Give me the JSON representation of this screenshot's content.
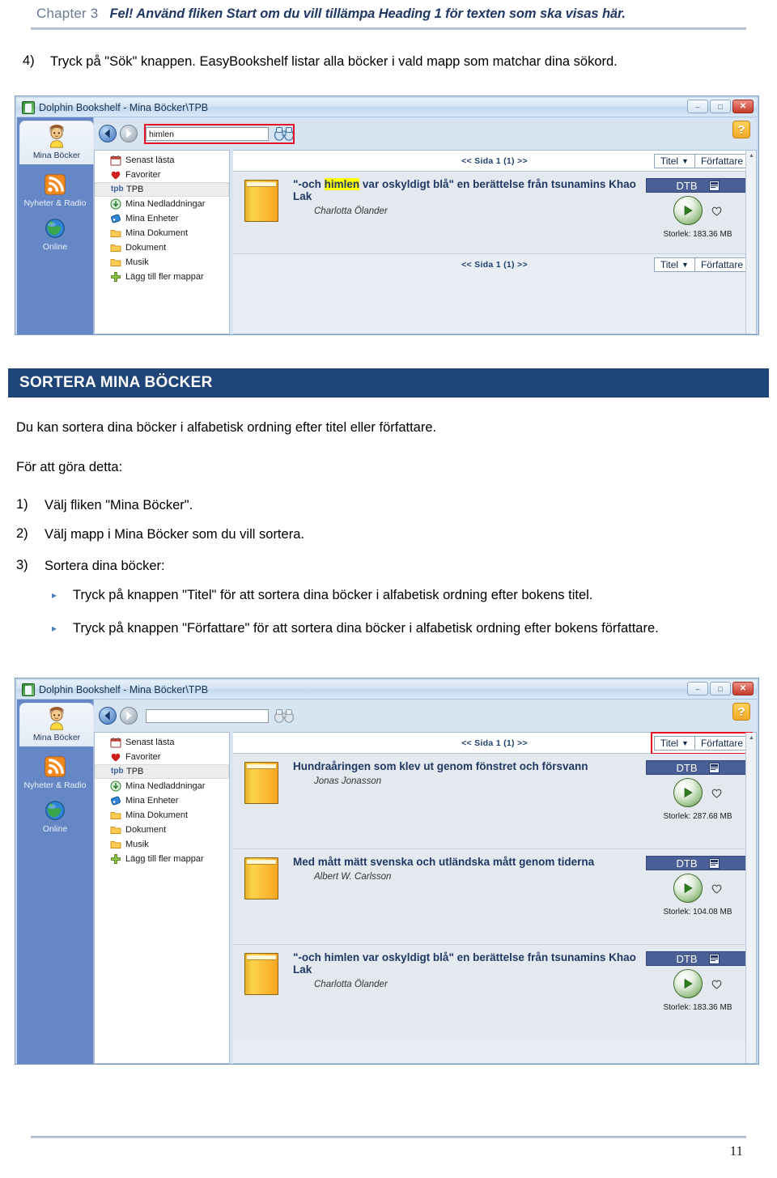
{
  "header": {
    "chapter": "Chapter 3",
    "title": "Fel! Använd fliken Start om du vill tillämpa Heading 1 för texten som ska visas här."
  },
  "body": {
    "step4_num": "4)",
    "step4_text": "Tryck på \"Sök\" knappen. EasyBookshelf listar alla böcker i vald mapp som matchar dina sökord.",
    "section_heading": "SORTERA MINA BÖCKER",
    "intro": "Du kan sortera dina böcker i alfabetisk ordning efter titel eller författare.",
    "howto": "För att göra detta:",
    "step1_num": "1)",
    "step1_text": "Välj fliken \"Mina Böcker\".",
    "step2_num": "2)",
    "step2_text": "Välj mapp i Mina Böcker som du vill sortera.",
    "step3_num": "3)",
    "step3_text": "Sortera dina böcker:",
    "bullet1": "Tryck på knappen \"Titel\" för att sortera dina böcker i alfabetisk ordning efter bokens titel.",
    "bullet2": "Tryck på knappen \"Författare\" för att sortera dina böcker i alfabetisk ordning efter bokens författare.",
    "bullet_glyph": "▸"
  },
  "footer": {
    "page_number": "11"
  },
  "app": {
    "window_title": "Dolphin Bookshelf - Mina Böcker\\TPB",
    "min_label": "–",
    "max_label": "□",
    "close_label": "✕",
    "help_label": "?",
    "rail": [
      {
        "label": "Mina Böcker",
        "icon": "user-avatar-icon"
      },
      {
        "label": "Nyheter & Radio",
        "icon": "rss-icon"
      },
      {
        "label": "Online",
        "icon": "globe-icon"
      }
    ],
    "tree": [
      {
        "label": "Senast lästa",
        "icon": "calendar-icon"
      },
      {
        "label": "Favoriter",
        "icon": "heart-icon"
      },
      {
        "label": "TPB",
        "icon": "tpb-icon"
      },
      {
        "label": "Mina Nedladdningar",
        "icon": "download-icon"
      },
      {
        "label": "Mina Enheter",
        "icon": "device-icon"
      },
      {
        "label": "Mina Dokument",
        "icon": "folder-icon"
      },
      {
        "label": "Dokument",
        "icon": "folder-icon"
      },
      {
        "label": "Musik",
        "icon": "folder-icon"
      },
      {
        "label": "Lägg till fler mappar",
        "icon": "plus-icon"
      }
    ],
    "pager_text": "<< Sida 1 (1) >>",
    "sort_titel": "Titel",
    "sort_caret": "▼",
    "sort_forfattare": "Författare",
    "dtb_label": "DTB",
    "size_prefix": "Storlek:"
  },
  "shot1": {
    "search_value": "himlen",
    "search_placeholder": "",
    "books": [
      {
        "title_pre": "\"-och ",
        "title_highlight": "himlen",
        "title_post": " var oskyldigt blå\" en berättelse från tsunamins Khao Lak",
        "author": "Charlotta Ölander",
        "size": "Storlek: 183.36 MB",
        "format": "DTB"
      }
    ]
  },
  "shot2": {
    "search_value": "",
    "search_placeholder": "",
    "books": [
      {
        "title": "Hundraåringen som klev ut genom fönstret och försvann",
        "author": "Jonas Jonasson",
        "size": "Storlek: 287.68 MB",
        "format": "DTB"
      },
      {
        "title": "Med mått mätt svenska och utländska mått genom tiderna",
        "author": "Albert W. Carlsson",
        "size": "Storlek: 104.08 MB",
        "format": "DTB"
      },
      {
        "title": "\"-och himlen var oskyldigt blå\" en berättelse från tsunamins Khao Lak",
        "author": "Charlotta Ölander",
        "size": "Storlek: 183.36 MB",
        "format": "DTB"
      }
    ]
  },
  "colors": {
    "header_blue": "#1f3864",
    "section_bar": "#1f4477",
    "rail_blue": "#6687c5",
    "highlight_yellow": "#ffff00",
    "accent_red": "#e81123"
  }
}
